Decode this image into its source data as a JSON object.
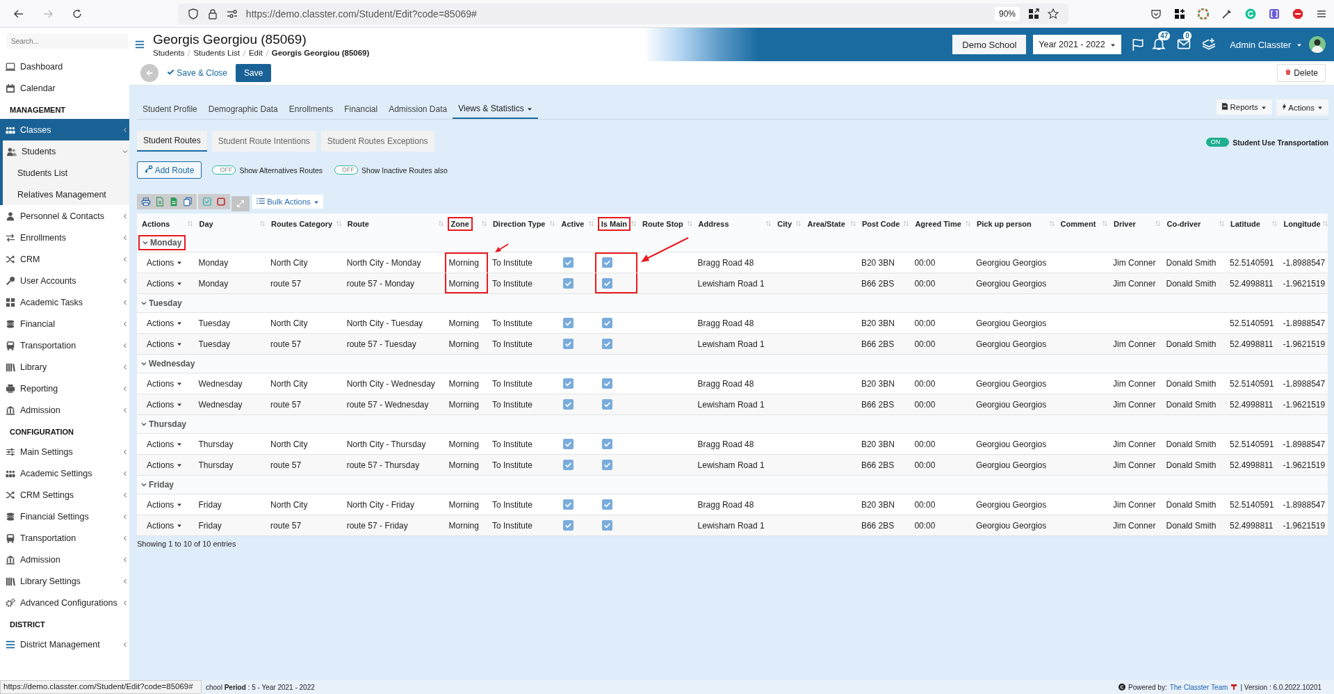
{
  "browser": {
    "url": "https://demo.classter.com/Student/Edit?code=85069#",
    "zoom": "90%"
  },
  "sidebar": {
    "search": {
      "placeholder": "Search..."
    },
    "sections": [
      {
        "items": [
          {
            "label": "Dashboard",
            "selected": false
          },
          {
            "label": "Calendar",
            "selected": false
          }
        ]
      },
      {
        "title": "MANAGEMENT",
        "items": [
          {
            "label": "Classes",
            "selected": true,
            "expanded": false,
            "children": [
              {
                "label": "Students",
                "expanded": true,
                "children": [
                  {
                    "label": "Students List"
                  },
                  {
                    "label": "Relatives Management"
                  }
                ]
              }
            ]
          },
          {
            "label": "Personnel & Contacts",
            "selected": false,
            "expanded": false
          },
          {
            "label": "Enrollments",
            "selected": false,
            "expanded": false
          },
          {
            "label": "CRM",
            "selected": false,
            "expanded": false
          },
          {
            "label": "User Accounts",
            "selected": false,
            "expanded": false
          },
          {
            "label": "Academic Tasks",
            "selected": false,
            "expanded": false
          },
          {
            "label": "Financial",
            "selected": false,
            "expanded": false
          },
          {
            "label": "Transportation",
            "selected": false,
            "expanded": false
          },
          {
            "label": "Library",
            "selected": false,
            "expanded": false
          },
          {
            "label": "Reporting",
            "selected": false,
            "expanded": false
          },
          {
            "label": "Admission",
            "selected": false,
            "expanded": false
          }
        ]
      },
      {
        "title": "CONFIGURATION",
        "items": [
          {
            "label": "Main Settings",
            "selected": false,
            "expanded": false
          },
          {
            "label": "Academic Settings",
            "selected": false,
            "expanded": false
          },
          {
            "label": "CRM Settings",
            "selected": false,
            "expanded": false
          },
          {
            "label": "Financial Settings",
            "selected": false,
            "expanded": false
          },
          {
            "label": "Transportation",
            "selected": false,
            "expanded": false
          },
          {
            "label": "Admission",
            "selected": false,
            "expanded": false
          },
          {
            "label": "Library Settings",
            "selected": false,
            "expanded": false
          },
          {
            "label": "Advanced Configurations",
            "selected": false,
            "expanded": false
          }
        ]
      },
      {
        "title": "DISTRICT",
        "items": [
          {
            "label": "District Management",
            "selected": false,
            "expanded": false
          }
        ]
      }
    ]
  },
  "header": {
    "title": "Georgis Georgiou (85069)",
    "breadcrumbs": [
      {
        "label": "Students",
        "current": false
      },
      {
        "label": "Students List",
        "current": false
      },
      {
        "label": "Edit",
        "current": false
      },
      {
        "label": "Georgis Georgiou (85069)",
        "current": true
      }
    ],
    "school": "Demo School",
    "year": "Year 2021 - 2022",
    "notifications": "47",
    "messages": "0",
    "user": "Admin Classter"
  },
  "toolbar": {
    "save_close": "Save & Close",
    "save": "Save",
    "delete": "Delete"
  },
  "tabs": [
    {
      "label": "Student Profile",
      "selected": false,
      "dropdown": false
    },
    {
      "label": "Demographic Data",
      "selected": false,
      "dropdown": false
    },
    {
      "label": "Enrollments",
      "selected": false,
      "dropdown": false
    },
    {
      "label": "Financial",
      "selected": false,
      "dropdown": false
    },
    {
      "label": "Admission Data",
      "selected": false,
      "dropdown": false
    },
    {
      "label": "Views & Statistics",
      "selected": true,
      "dropdown": true
    }
  ],
  "tab_actions": [
    "Reports",
    "Actions"
  ],
  "subtabs": [
    {
      "label": "Student Routes",
      "selected": true
    },
    {
      "label": "Student Route Intentions",
      "selected": false
    },
    {
      "label": "Student Routes Exceptions",
      "selected": false
    }
  ],
  "add_route": "Add Route",
  "toggles": [
    {
      "state_label": "OFF",
      "on": false,
      "label": "Show Alternatives Routes"
    },
    {
      "state_label": "OFF",
      "on": false,
      "label": "Show Inactive Routes also"
    }
  ],
  "transport_toggle": {
    "state_label": "ON",
    "on": true,
    "label": "Student Use Transportation"
  },
  "bulk_actions": "Bulk Actions",
  "table": {
    "columns": [
      {
        "label": "Actions",
        "highlighted": false
      },
      {
        "label": "Day",
        "highlighted": false
      },
      {
        "label": "Routes Category",
        "highlighted": false
      },
      {
        "label": "Route",
        "highlighted": false
      },
      {
        "label": "Zone",
        "highlighted": true
      },
      {
        "label": "Direction Type",
        "highlighted": false
      },
      {
        "label": "Active",
        "highlighted": false
      },
      {
        "label": "Is Main",
        "highlighted": true
      },
      {
        "label": "Route Stop",
        "highlighted": false
      },
      {
        "label": "Address",
        "highlighted": false
      },
      {
        "label": "City",
        "highlighted": false
      },
      {
        "label": "Area/State",
        "highlighted": false
      },
      {
        "label": "Post Code",
        "highlighted": false
      },
      {
        "label": "Agreed Time",
        "highlighted": false
      },
      {
        "label": "Pick up person",
        "highlighted": false
      },
      {
        "label": "Comment",
        "highlighted": false
      },
      {
        "label": "Driver",
        "highlighted": false
      },
      {
        "label": "Co-driver",
        "highlighted": false
      },
      {
        "label": "Latitude",
        "highlighted": false
      },
      {
        "label": "Longitude",
        "highlighted": false
      }
    ],
    "groups": [
      {
        "day": "Monday",
        "expanded": true,
        "highlighted": true,
        "rows": [
          {
            "actions": "Actions",
            "day": "Monday",
            "category": "North City",
            "route": "North City - Monday",
            "zone": "Morning",
            "direction": "To Institute",
            "active": true,
            "is_main": true,
            "address": "Bragg Road 48",
            "post_code": "B20 3BN",
            "agreed_time": "00:00",
            "pickup": "Georgiou Georgios",
            "driver": "Jim Conner",
            "codriver": "Donald Smith",
            "latitude": "52.5140591",
            "longitude": "-1.8988547"
          },
          {
            "actions": "Actions",
            "day": "Monday",
            "category": "route 57",
            "route": "route 57 - Monday",
            "zone": "Morning",
            "direction": "To Institute",
            "active": true,
            "is_main": true,
            "address": "Lewisham Road 1",
            "post_code": "B66 2BS",
            "agreed_time": "00:00",
            "pickup": "Georgiou Georgios",
            "driver": "Jim Conner",
            "codriver": "Donald Smith",
            "latitude": "52.4998811",
            "longitude": "-1.9621519"
          }
        ]
      },
      {
        "day": "Tuesday",
        "expanded": true,
        "highlighted": false,
        "rows": [
          {
            "actions": "Actions",
            "day": "Tuesday",
            "category": "North City",
            "route": "North City - Tuesday",
            "zone": "Morning",
            "direction": "To Institute",
            "active": true,
            "is_main": true,
            "address": "Bragg Road 48",
            "post_code": "B20 3BN",
            "agreed_time": "00:00",
            "pickup": "Georgiou Georgios",
            "latitude": "52.5140591",
            "longitude": "-1.8988547"
          },
          {
            "actions": "Actions",
            "day": "Tuesday",
            "category": "route 57",
            "route": "route 57 - Tuesday",
            "zone": "Morning",
            "direction": "To Institute",
            "active": true,
            "is_main": true,
            "address": "Lewisham Road 1",
            "post_code": "B66 2BS",
            "agreed_time": "00:00",
            "pickup": "Georgiou Georgios",
            "driver": "Jim Conner",
            "codriver": "Donald Smith",
            "latitude": "52.4998811",
            "longitude": "-1.9621519"
          }
        ]
      },
      {
        "day": "Wednesday",
        "expanded": true,
        "highlighted": false,
        "rows": [
          {
            "actions": "Actions",
            "day": "Wednesday",
            "category": "North City",
            "route": "North City - Wednesday",
            "zone": "Morning",
            "direction": "To Institute",
            "active": true,
            "is_main": true,
            "address": "Bragg Road 48",
            "post_code": "B20 3BN",
            "agreed_time": "00:00",
            "pickup": "Georgiou Georgios",
            "driver": "Jim Conner",
            "codriver": "Donald Smith",
            "latitude": "52.5140591",
            "longitude": "-1.8988547"
          },
          {
            "actions": "Actions",
            "day": "Wednesday",
            "category": "route 57",
            "route": "route 57 - Wednesday",
            "zone": "Morning",
            "direction": "To Institute",
            "active": true,
            "is_main": true,
            "address": "Lewisham Road 1",
            "post_code": "B66 2BS",
            "agreed_time": "00:00",
            "pickup": "Georgiou Georgios",
            "driver": "Jim Conner",
            "codriver": "Donald Smith",
            "latitude": "52.4998811",
            "longitude": "-1.9621519"
          }
        ]
      },
      {
        "day": "Thursday",
        "expanded": true,
        "highlighted": false,
        "rows": [
          {
            "actions": "Actions",
            "day": "Thursday",
            "category": "North City",
            "route": "North City - Thursday",
            "zone": "Morning",
            "direction": "To Institute",
            "active": true,
            "is_main": true,
            "address": "Bragg Road 48",
            "post_code": "B20 3BN",
            "agreed_time": "00:00",
            "pickup": "Georgiou Georgios",
            "driver": "Jim Conner",
            "codriver": "Donald Smith",
            "latitude": "52.5140591",
            "longitude": "-1.8988547"
          },
          {
            "actions": "Actions",
            "day": "Thursday",
            "category": "route 57",
            "route": "route 57 - Thursday",
            "zone": "Morning",
            "direction": "To Institute",
            "active": true,
            "is_main": true,
            "address": "Lewisham Road 1",
            "post_code": "B66 2BS",
            "agreed_time": "00:00",
            "pickup": "Georgiou Georgios",
            "driver": "Jim Conner",
            "codriver": "Donald Smith",
            "latitude": "52.4998811",
            "longitude": "-1.9621519"
          }
        ]
      },
      {
        "day": "Friday",
        "expanded": true,
        "highlighted": false,
        "rows": [
          {
            "actions": "Actions",
            "day": "Friday",
            "category": "North City",
            "route": "North City - Friday",
            "zone": "Morning",
            "direction": "To Institute",
            "active": true,
            "is_main": true,
            "address": "Bragg Road 48",
            "post_code": "B20 3BN",
            "agreed_time": "00:00",
            "pickup": "Georgiou Georgios",
            "driver": "Jim Conner",
            "codriver": "Donald Smith",
            "latitude": "52.5140591",
            "longitude": "-1.8988547"
          },
          {
            "actions": "Actions",
            "day": "Friday",
            "category": "route 57",
            "route": "route 57 - Friday",
            "zone": "Morning",
            "direction": "To Institute",
            "active": true,
            "is_main": true,
            "address": "Lewisham Road 1",
            "post_code": "B66 2BS",
            "agreed_time": "00:00",
            "pickup": "Georgiou Georgios",
            "driver": "Jim Conner",
            "codriver": "Donald Smith",
            "latitude": "52.4998811",
            "longitude": "-1.9621519"
          }
        ]
      }
    ],
    "info": "Showing 1 to 10 of 10 entries"
  },
  "status_bar": {
    "period": "chool **Period** : 5 - Year 2021 - 2022",
    "powered_by": "Powered by:",
    "team": "The Classter Team",
    "version": "| Version : 6.0.2022.10201",
    "link_preview": "https://demo.classter.com/Student/Edit?code=85069#"
  }
}
